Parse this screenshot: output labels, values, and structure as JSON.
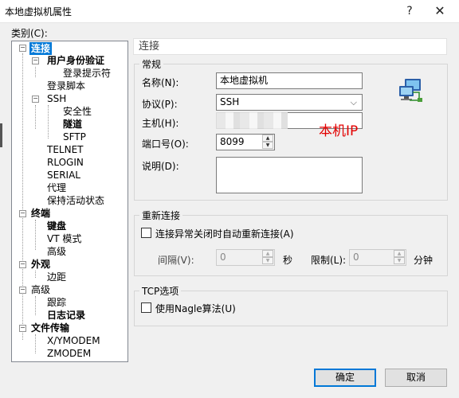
{
  "window": {
    "title": "本地虚拟机属性",
    "help": "?",
    "close": "✕"
  },
  "category_label": "类别(C):",
  "tree": {
    "connection": "连接",
    "user_auth": "用户身份验证",
    "login_prompt": "登录提示符",
    "login_script": "登录脚本",
    "ssh": "SSH",
    "security": "安全性",
    "tunnel": "隧道",
    "sftp": "SFTP",
    "telnet": "TELNET",
    "rlogin": "RLOGIN",
    "serial": "SERIAL",
    "proxy": "代理",
    "keepalive": "保持活动状态",
    "terminal": "终端",
    "keyboard": "键盘",
    "vt_mode": "VT 模式",
    "advanced1": "高级",
    "appearance": "外观",
    "margin": "边距",
    "advanced2": "高级",
    "trace": "跟踪",
    "log": "日志记录",
    "file_transfer": "文件传输",
    "xymodem": "X/YMODEM",
    "zmodem": "ZMODEM"
  },
  "section_title": "连接",
  "general": {
    "legend": "常规",
    "name_label": "名称(N):",
    "name_value": "本地虚拟机",
    "protocol_label": "协议(P):",
    "protocol_value": "SSH",
    "host_label": "主机(H):",
    "port_label": "端口号(O):",
    "port_value": "8099",
    "desc_label": "说明(D):"
  },
  "annotation": "本机IP",
  "reconnect": {
    "legend": "重新连接",
    "checkbox_label": "连接异常关闭时自动重新连接(A)",
    "interval_label": "间隔(V):",
    "interval_value": "0",
    "interval_unit": "秒",
    "limit_label": "限制(L):",
    "limit_value": "0",
    "limit_unit": "分钟"
  },
  "tcp": {
    "legend": "TCP选项",
    "nagle_label": "使用Nagle算法(U)"
  },
  "buttons": {
    "ok": "确定",
    "cancel": "取消"
  }
}
